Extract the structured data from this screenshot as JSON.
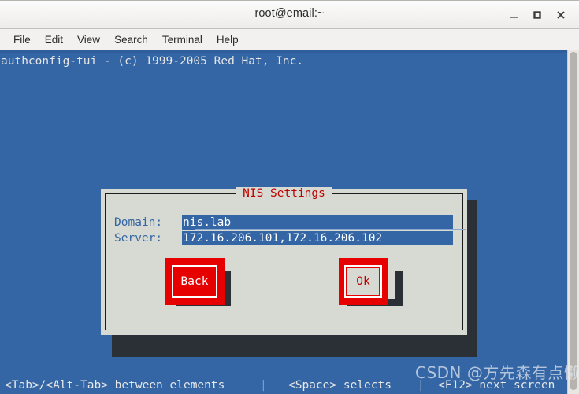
{
  "window": {
    "title": "root@email:~",
    "controls": [
      {
        "name": "minimize",
        "label": "_"
      },
      {
        "name": "maximize",
        "label": "□"
      },
      {
        "name": "close",
        "label": "✕"
      }
    ]
  },
  "menubar": {
    "items": [
      {
        "label": "File"
      },
      {
        "label": "Edit"
      },
      {
        "label": "View"
      },
      {
        "label": "Search"
      },
      {
        "label": "Terminal"
      },
      {
        "label": "Help"
      }
    ]
  },
  "terminal": {
    "banner": "authconfig-tui - (c) 1999-2005 Red Hat, Inc.",
    "background_color": "#3465a4",
    "foreground_color": "#e6e6e6"
  },
  "dialog": {
    "title": "NIS Settings",
    "title_color": "#c00000",
    "background_color": "#d7dad3",
    "fields": [
      {
        "label": "Domain:",
        "value": "nis.lab"
      },
      {
        "label": "Server:",
        "value": "172.16.206.101,172.16.206.102"
      }
    ],
    "buttons": [
      {
        "label": "Back",
        "focused": false
      },
      {
        "label": "Ok",
        "focused": true
      }
    ],
    "annotation_color": "#e60000"
  },
  "statusbar": {
    "hint_tab": "<Tab>/<Alt-Tab> between elements",
    "separator_1": "|",
    "hint_space": "<Space> selects",
    "separator_2": "|",
    "hint_f12": "<F12> next screen"
  },
  "watermark": {
    "text": "CSDN @方先森有点懒"
  }
}
